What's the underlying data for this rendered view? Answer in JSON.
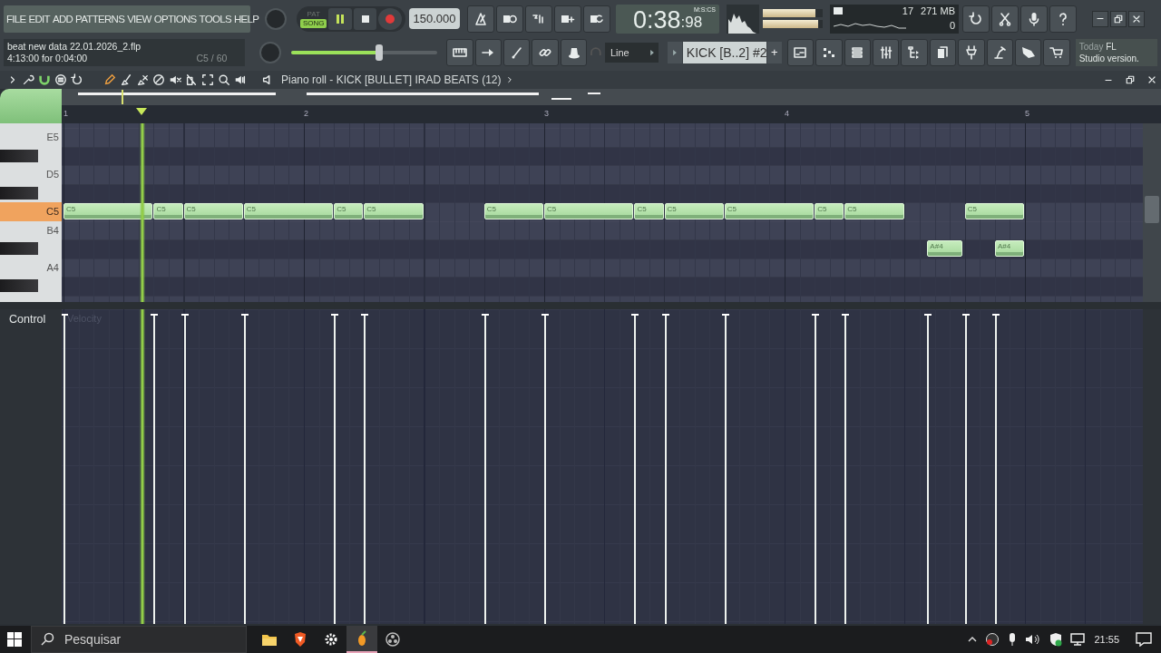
{
  "menu": [
    {
      "label": "FILE"
    },
    {
      "label": "EDIT"
    },
    {
      "label": "ADD"
    },
    {
      "label": "PATTERNS"
    },
    {
      "label": "VIEW"
    },
    {
      "label": "OPTIONS"
    },
    {
      "label": "TOOLS"
    },
    {
      "label": "HELP"
    }
  ],
  "transport": {
    "modes": [
      {
        "label": "PAT",
        "selected": false
      },
      {
        "label": "SONG",
        "selected": true
      }
    ],
    "tempo": "150.000"
  },
  "time_display": {
    "main": "0:38",
    "centiseconds": ":98",
    "format": "M:S:CS"
  },
  "output_meters": [
    {
      "level": 0.88
    },
    {
      "level": 0.93
    }
  ],
  "performance": {
    "polyphony": "17",
    "memory": "271 MB",
    "cpu": "0"
  },
  "project": {
    "file": "beat new data 22.01.2026_2.flp",
    "position": "4:13:00 for 0:04:00",
    "note": "C5 / 60"
  },
  "master_volume": {
    "level": 0.6
  },
  "snap": {
    "value": "Line"
  },
  "pattern": {
    "name": "KICK [B..2] #2",
    "add": "+"
  },
  "hint": {
    "label": "Today",
    "title": "FL",
    "text": "Studio version."
  },
  "piano_roll": {
    "title": "Piano roll - KICK [BULLET] IRAD BEATS (12)",
    "ruler": [
      "1",
      "2",
      "3",
      "4",
      "5"
    ],
    "keys": [
      {
        "label": "E5",
        "selected": false
      },
      {
        "label": "D5",
        "selected": false
      },
      {
        "label": "C5",
        "selected": true
      },
      {
        "label": "B4",
        "selected": false
      },
      {
        "label": "A4",
        "selected": false
      }
    ],
    "notes": [
      {
        "label": "C5"
      },
      {
        "label": "C5"
      },
      {
        "label": "C5"
      },
      {
        "label": "C5"
      },
      {
        "label": "C5"
      },
      {
        "label": "C5"
      },
      {
        "label": "C5"
      },
      {
        "label": "C5"
      },
      {
        "label": "C5"
      },
      {
        "label": "C5"
      },
      {
        "label": "C5"
      },
      {
        "label": "C5"
      },
      {
        "label": "C5"
      },
      {
        "label": "A#4"
      },
      {
        "label": "C5"
      },
      {
        "label": "A#4"
      }
    ],
    "event_editor": {
      "control": "Control",
      "parameter": "Velocity"
    }
  },
  "taskbar": {
    "search": {
      "placeholder": "Pesquisar"
    },
    "clock": "21:55"
  }
}
